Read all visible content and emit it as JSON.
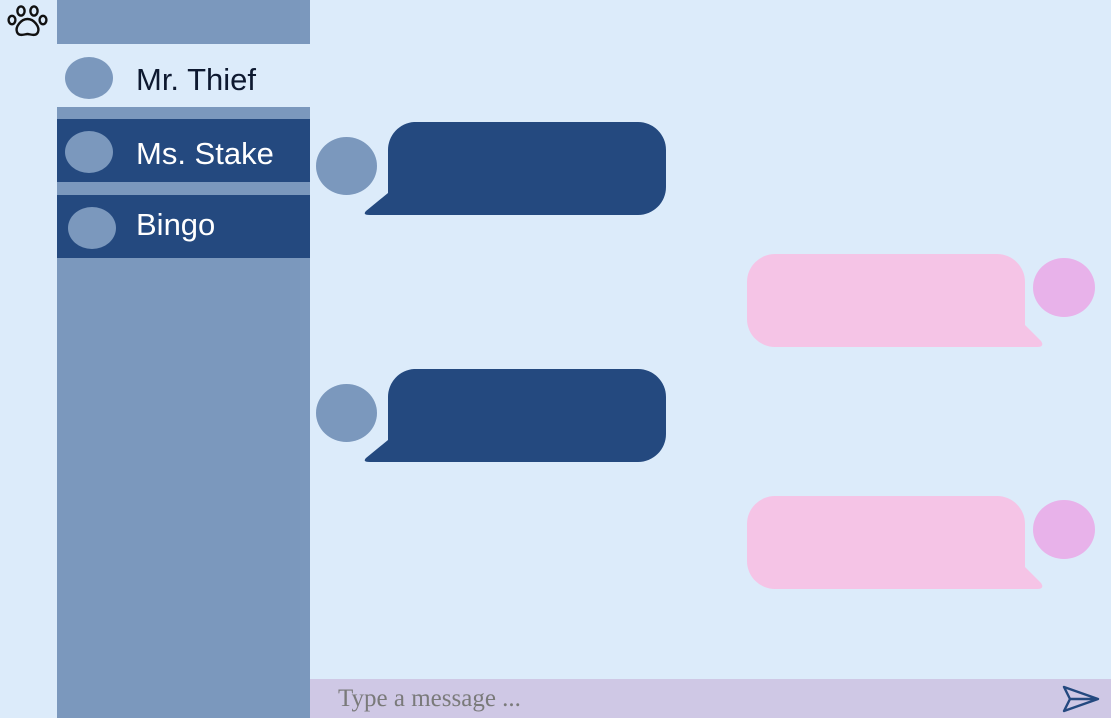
{
  "app": {
    "logo_icon": "paw-icon"
  },
  "sidebar": {
    "contacts": [
      {
        "name": "Mr. Thief",
        "active": true
      },
      {
        "name": "Ms. Stake",
        "active": false
      },
      {
        "name": "Bingo",
        "active": false
      }
    ]
  },
  "chat": {
    "messages": [
      {
        "from": "contact",
        "text": ""
      },
      {
        "from": "self",
        "text": ""
      },
      {
        "from": "contact",
        "text": ""
      },
      {
        "from": "self",
        "text": ""
      }
    ]
  },
  "composer": {
    "placeholder": "Type a message ...",
    "send_icon": "send-icon"
  },
  "colors": {
    "background": "#dcebfa",
    "sidebar": "#7b98bd",
    "contact_active_bg": "#dcebfa",
    "contact_inactive_bg": "#24497f",
    "incoming_bubble": "#24497f",
    "incoming_avatar": "#7b98bd",
    "outgoing_bubble": "#f5c4e6",
    "outgoing_avatar": "#e8b2ea",
    "input_bar": "#cfc8e5",
    "send_icon": "#24497f"
  }
}
